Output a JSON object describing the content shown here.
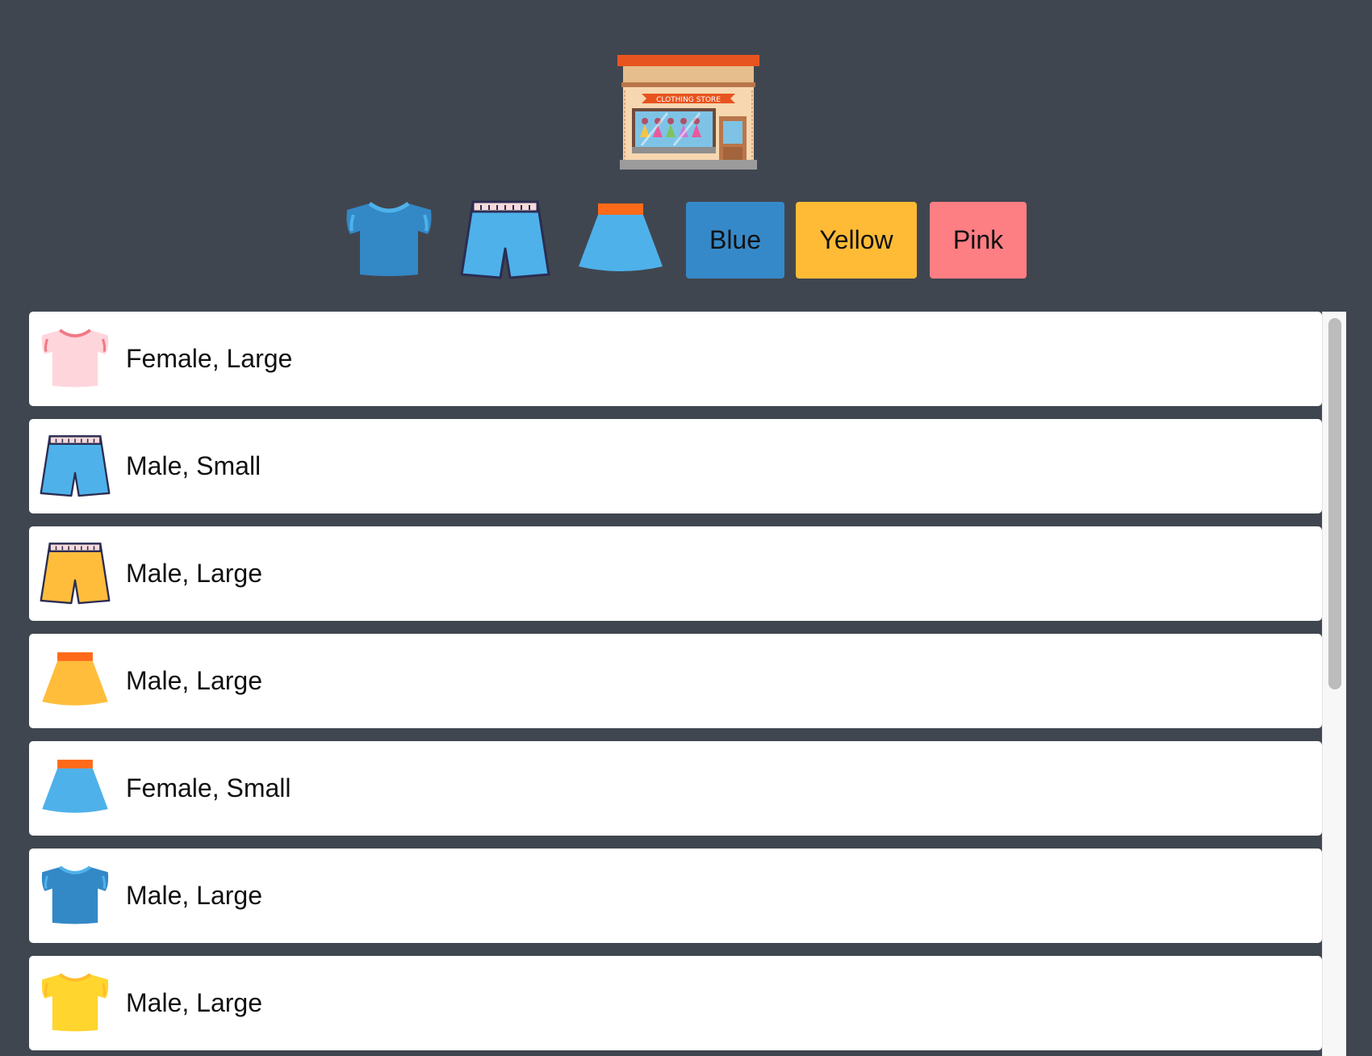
{
  "store": {
    "logo_icon": "clothing-store-icon",
    "sign_text": "CLOTHING STORE"
  },
  "toolbar": {
    "type_filters": [
      {
        "icon": "tshirt-icon",
        "color": "#3388c6"
      },
      {
        "icon": "shorts-icon",
        "color": "#4eb1ea"
      },
      {
        "icon": "skirt-icon",
        "color": "#4eb1ea"
      }
    ],
    "color_filters": [
      {
        "label": "Blue",
        "color": "#3689c9"
      },
      {
        "label": "Yellow",
        "color": "#ffbb36"
      },
      {
        "label": "Pink",
        "color": "#fd7e83"
      }
    ]
  },
  "items": [
    {
      "icon": "tshirt-icon",
      "color": "#ffd5dc",
      "label": "Female, Large"
    },
    {
      "icon": "shorts-icon",
      "color": "#4eb1ea",
      "label": "Male, Small"
    },
    {
      "icon": "shorts-icon",
      "color": "#ffbd3b",
      "label": "Male, Large"
    },
    {
      "icon": "skirt-icon",
      "color": "#ffbd3b",
      "label": "Male, Large"
    },
    {
      "icon": "skirt-icon",
      "color": "#4eb1ea",
      "label": "Female, Small"
    },
    {
      "icon": "tshirt-icon",
      "color": "#3388c6",
      "label": "Male, Large"
    },
    {
      "icon": "tshirt-icon",
      "color": "#ffd52e",
      "label": "Male, Large"
    }
  ]
}
